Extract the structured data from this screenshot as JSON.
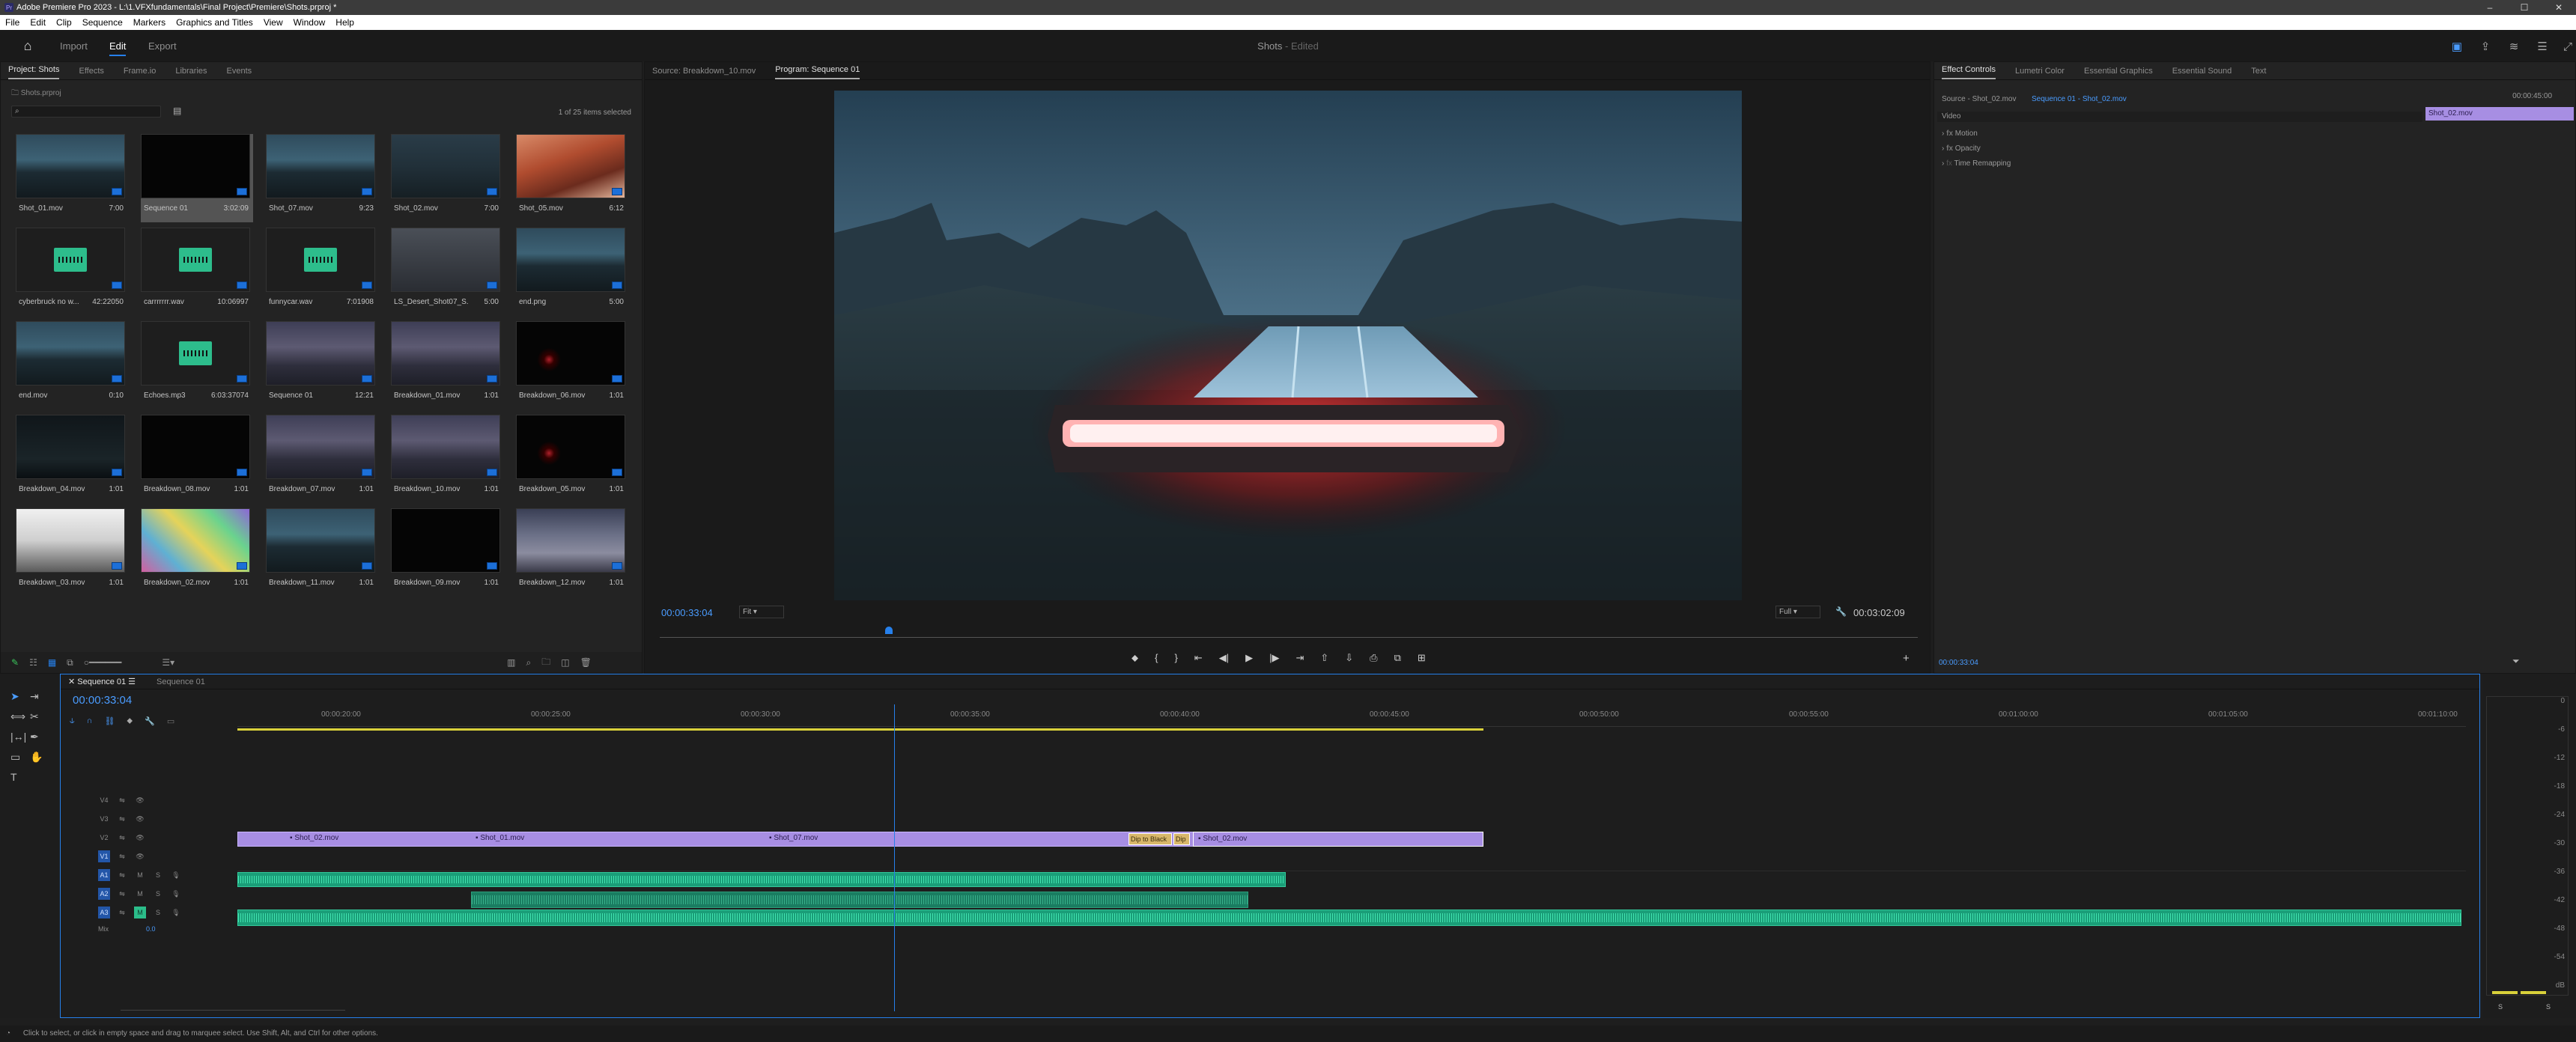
{
  "titlebar": {
    "title": "Adobe Premiere Pro 2023 - L:\\1.VFXfundamentals\\Final Project\\Premiere\\Shots.prproj *",
    "minimize": "–",
    "maximize": "☐",
    "close": "✕"
  },
  "menubar": [
    "File",
    "Edit",
    "Clip",
    "Sequence",
    "Markers",
    "Graphics and Titles",
    "View",
    "Window",
    "Help"
  ],
  "workspace": {
    "tabs": [
      "Import",
      "Edit",
      "Export"
    ],
    "active": "Edit",
    "project_name": "Shots",
    "project_status": "- Edited"
  },
  "project": {
    "tabs": [
      "Project: Shots",
      "Effects",
      "Frame.io",
      "Libraries",
      "Events"
    ],
    "path": "Shots.prproj",
    "search_placeholder": "",
    "count": "1 of 25 items selected",
    "items": [
      {
        "name": "Shot_01.mov",
        "dur": "7:00",
        "kind": "canyon"
      },
      {
        "name": "Sequence 01",
        "dur": "3:02:09",
        "kind": "black"
      },
      {
        "name": "Shot_07.mov",
        "dur": "9:23",
        "kind": "canyon"
      },
      {
        "name": "Shot_02.mov",
        "dur": "7:00",
        "kind": "dark"
      },
      {
        "name": "Shot_05.mov",
        "dur": "6:12",
        "kind": "desert"
      },
      {
        "name": "cyberbruck no w...",
        "dur": "42:22050",
        "kind": "audio"
      },
      {
        "name": "carrrrrrr.wav",
        "dur": "10:06997",
        "kind": "audio"
      },
      {
        "name": "funnycar.wav",
        "dur": "7:01908",
        "kind": "audio"
      },
      {
        "name": "LS_Desert_Shot07_S...",
        "dur": "5:00",
        "kind": "grey"
      },
      {
        "name": "end.png",
        "dur": "5:00",
        "kind": "canyon"
      },
      {
        "name": "end.mov",
        "dur": "0:10",
        "kind": "canyon"
      },
      {
        "name": "Echoes.mp3",
        "dur": "6:03:37074",
        "kind": "audio"
      },
      {
        "name": "Sequence 01",
        "dur": "12:21",
        "kind": "dusk"
      },
      {
        "name": "Breakdown_01.mov",
        "dur": "1:01",
        "kind": "dusk"
      },
      {
        "name": "Breakdown_06.mov",
        "dur": "1:01",
        "kind": "redlight"
      },
      {
        "name": "Breakdown_04.mov",
        "dur": "1:01",
        "kind": "darkgreen"
      },
      {
        "name": "Breakdown_08.mov",
        "dur": "1:01",
        "kind": "black"
      },
      {
        "name": "Breakdown_07.mov",
        "dur": "1:01",
        "kind": "dusk"
      },
      {
        "name": "Breakdown_10.mov",
        "dur": "1:01",
        "kind": "dusk"
      },
      {
        "name": "Breakdown_05.mov",
        "dur": "1:01",
        "kind": "redlight"
      },
      {
        "name": "Breakdown_03.mov",
        "dur": "1:01",
        "kind": "white"
      },
      {
        "name": "Breakdown_02.mov",
        "dur": "1:01",
        "kind": "colorful"
      },
      {
        "name": "Breakdown_11.mov",
        "dur": "1:01",
        "kind": "canyon"
      },
      {
        "name": "Breakdown_09.mov",
        "dur": "1:01",
        "kind": "black"
      },
      {
        "name": "Breakdown_12.mov",
        "dur": "1:01",
        "kind": "crowd"
      }
    ]
  },
  "monitor": {
    "source_tab": "Source: Breakdown_10.mov",
    "program_tab": "Program: Sequence 01",
    "timecode": "00:00:33:04",
    "fit": "Fit",
    "quality": "Full",
    "duration": "00:03:02:09",
    "playhead_fraction": 0.182
  },
  "effects": {
    "tabs": [
      "Effect Controls",
      "Lumetri Color",
      "Essential Graphics",
      "Essential Sound",
      "Text"
    ],
    "source": "Source - Shot_02.mov",
    "sequence": "Sequence 01 - Shot_02.mov",
    "time_label": "00:00:45:00",
    "clip_label": "Shot_02.mov",
    "section": "Video",
    "props": [
      "Motion",
      "Opacity",
      "Time Remapping"
    ],
    "footer_time": "00:00:33:04"
  },
  "timeline": {
    "tabs": [
      "Sequence 01",
      "Sequence 01"
    ],
    "timecode": "00:00:33:04",
    "ticks": [
      "00:00:20:00",
      "00:00:25:00",
      "00:00:30:00",
      "00:00:35:00",
      "00:00:40:00",
      "00:00:45:00",
      "00:00:50:00",
      "00:00:55:00",
      "00:01:00:00",
      "00:01:05:00",
      "00:01:10:00"
    ],
    "tracks_video": [
      "V4",
      "V3",
      "V2",
      "V1"
    ],
    "tracks_audio": [
      "A1",
      "A2",
      "A3"
    ],
    "mix": "Mix",
    "mix_value": "0.0",
    "clips": [
      "Shot_02.mov",
      "Shot_01.mov",
      "Shot_07.mov",
      "Dip to Black",
      "Dip t",
      "Shot_02.mov"
    ],
    "meter_scale": [
      "0",
      "-6",
      "-12",
      "-18",
      "-24",
      "-30",
      "-36",
      "-42",
      "-48",
      "-54",
      "dB"
    ],
    "meter_bottom": [
      "S",
      "S"
    ]
  },
  "status": "Click to select, or click in empty space and drag to marquee select. Use Shift, Alt, and Ctrl for other options."
}
